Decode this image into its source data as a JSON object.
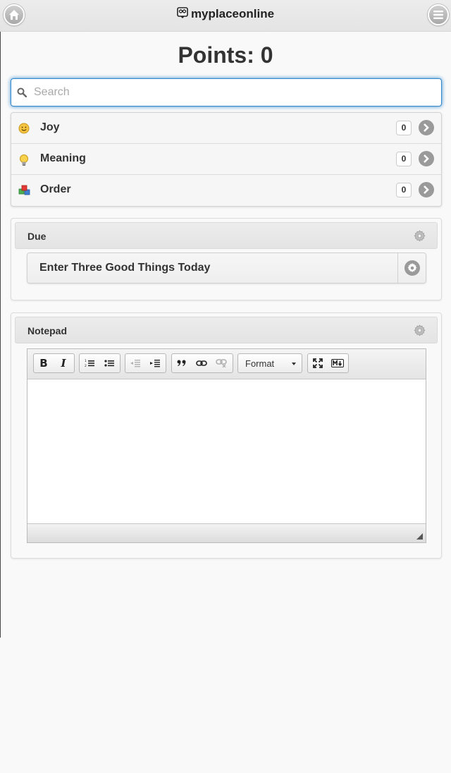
{
  "header": {
    "brand": "myplaceonline",
    "home_icon": "home-icon",
    "menu_icon": "hamburger-menu-icon",
    "logo_icon": "owl-logo-icon"
  },
  "points_label": "Points: 0",
  "search": {
    "placeholder": "Search",
    "value": ""
  },
  "categories": [
    {
      "label": "Joy",
      "count": "0",
      "icon": "smiley-icon"
    },
    {
      "label": "Meaning",
      "count": "0",
      "icon": "lightbulb-icon"
    },
    {
      "label": "Order",
      "count": "0",
      "icon": "blocks-icon"
    }
  ],
  "due": {
    "title": "Due",
    "items": [
      {
        "label": "Enter Three Good Things Today"
      }
    ]
  },
  "notepad": {
    "title": "Notepad",
    "toolbar": {
      "bold": "B",
      "italic": "I",
      "format_label": "Format"
    },
    "content": ""
  },
  "colors": {
    "accent": "#3388cc",
    "header_bg": "#e9e9e9",
    "arrow_bg": "#9a9a9a"
  }
}
